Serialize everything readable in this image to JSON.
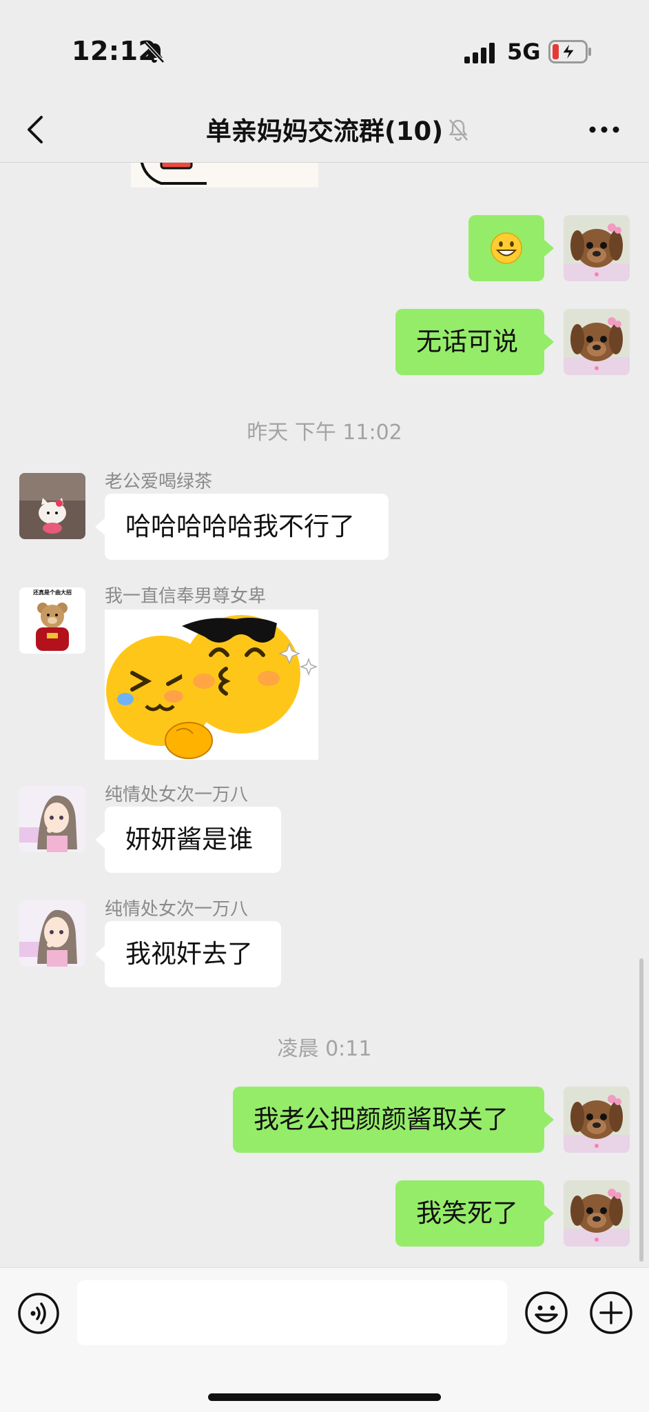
{
  "status_bar": {
    "time": "12:12",
    "network": "5G"
  },
  "nav": {
    "title": "单亲妈妈交流群(10)"
  },
  "messages": {
    "m1": {
      "text": "😀"
    },
    "m2": {
      "text": "无话可说"
    },
    "ts1": {
      "text": "昨天 下午 11:02"
    },
    "m3": {
      "sender": "老公爱喝绿茶",
      "text": "哈哈哈哈哈我不行了"
    },
    "m4": {
      "sender": "我一直信奉男尊女卑",
      "avatar_caption": "还真是个曲大招"
    },
    "m5": {
      "sender": "纯情处女次一万八",
      "text": "妍妍酱是谁"
    },
    "m6": {
      "sender": "纯情处女次一万八",
      "text": "我视奸去了"
    },
    "ts2": {
      "text": "凌晨 0:11"
    },
    "m7": {
      "text": "我老公把颜颜酱取关了"
    },
    "m8": {
      "text": "我笑死了"
    }
  },
  "input": {
    "placeholder": ""
  },
  "colors": {
    "my_bubble": "#95ec69",
    "other_bubble": "#ffffff",
    "background": "#ededed"
  }
}
